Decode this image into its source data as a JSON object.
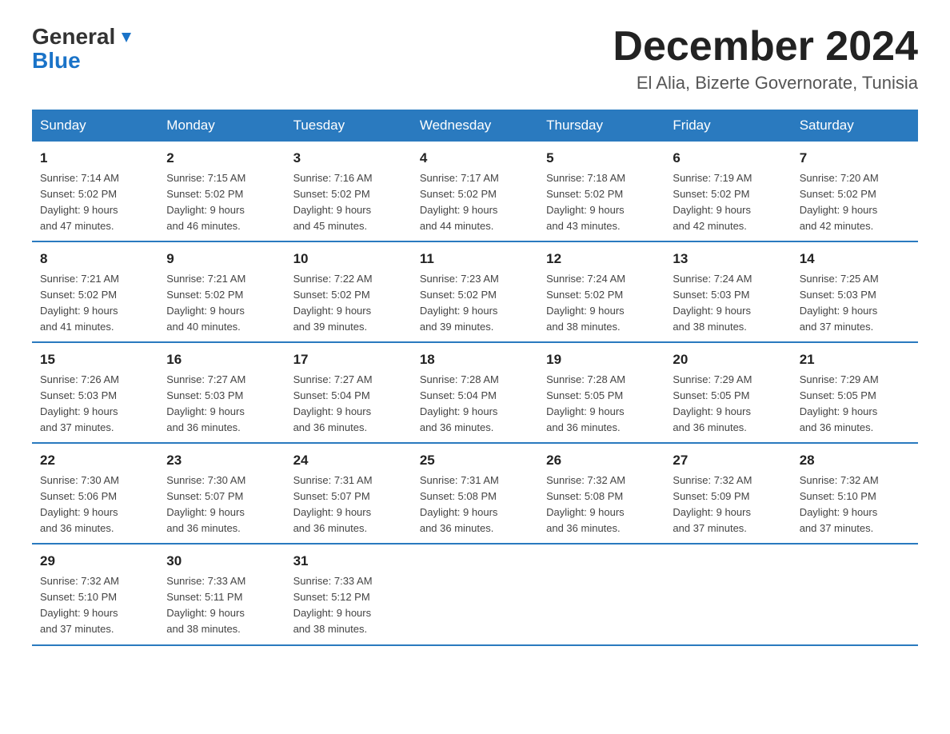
{
  "header": {
    "title": "December 2024",
    "subtitle": "El Alia, Bizerte Governorate, Tunisia",
    "logo_general": "General",
    "logo_blue": "Blue"
  },
  "days_of_week": [
    "Sunday",
    "Monday",
    "Tuesday",
    "Wednesday",
    "Thursday",
    "Friday",
    "Saturday"
  ],
  "weeks": [
    [
      {
        "day": "1",
        "sunrise": "7:14 AM",
        "sunset": "5:02 PM",
        "daylight": "9 hours and 47 minutes."
      },
      {
        "day": "2",
        "sunrise": "7:15 AM",
        "sunset": "5:02 PM",
        "daylight": "9 hours and 46 minutes."
      },
      {
        "day": "3",
        "sunrise": "7:16 AM",
        "sunset": "5:02 PM",
        "daylight": "9 hours and 45 minutes."
      },
      {
        "day": "4",
        "sunrise": "7:17 AM",
        "sunset": "5:02 PM",
        "daylight": "9 hours and 44 minutes."
      },
      {
        "day": "5",
        "sunrise": "7:18 AM",
        "sunset": "5:02 PM",
        "daylight": "9 hours and 43 minutes."
      },
      {
        "day": "6",
        "sunrise": "7:19 AM",
        "sunset": "5:02 PM",
        "daylight": "9 hours and 42 minutes."
      },
      {
        "day": "7",
        "sunrise": "7:20 AM",
        "sunset": "5:02 PM",
        "daylight": "9 hours and 42 minutes."
      }
    ],
    [
      {
        "day": "8",
        "sunrise": "7:21 AM",
        "sunset": "5:02 PM",
        "daylight": "9 hours and 41 minutes."
      },
      {
        "day": "9",
        "sunrise": "7:21 AM",
        "sunset": "5:02 PM",
        "daylight": "9 hours and 40 minutes."
      },
      {
        "day": "10",
        "sunrise": "7:22 AM",
        "sunset": "5:02 PM",
        "daylight": "9 hours and 39 minutes."
      },
      {
        "day": "11",
        "sunrise": "7:23 AM",
        "sunset": "5:02 PM",
        "daylight": "9 hours and 39 minutes."
      },
      {
        "day": "12",
        "sunrise": "7:24 AM",
        "sunset": "5:02 PM",
        "daylight": "9 hours and 38 minutes."
      },
      {
        "day": "13",
        "sunrise": "7:24 AM",
        "sunset": "5:03 PM",
        "daylight": "9 hours and 38 minutes."
      },
      {
        "day": "14",
        "sunrise": "7:25 AM",
        "sunset": "5:03 PM",
        "daylight": "9 hours and 37 minutes."
      }
    ],
    [
      {
        "day": "15",
        "sunrise": "7:26 AM",
        "sunset": "5:03 PM",
        "daylight": "9 hours and 37 minutes."
      },
      {
        "day": "16",
        "sunrise": "7:27 AM",
        "sunset": "5:03 PM",
        "daylight": "9 hours and 36 minutes."
      },
      {
        "day": "17",
        "sunrise": "7:27 AM",
        "sunset": "5:04 PM",
        "daylight": "9 hours and 36 minutes."
      },
      {
        "day": "18",
        "sunrise": "7:28 AM",
        "sunset": "5:04 PM",
        "daylight": "9 hours and 36 minutes."
      },
      {
        "day": "19",
        "sunrise": "7:28 AM",
        "sunset": "5:05 PM",
        "daylight": "9 hours and 36 minutes."
      },
      {
        "day": "20",
        "sunrise": "7:29 AM",
        "sunset": "5:05 PM",
        "daylight": "9 hours and 36 minutes."
      },
      {
        "day": "21",
        "sunrise": "7:29 AM",
        "sunset": "5:05 PM",
        "daylight": "9 hours and 36 minutes."
      }
    ],
    [
      {
        "day": "22",
        "sunrise": "7:30 AM",
        "sunset": "5:06 PM",
        "daylight": "9 hours and 36 minutes."
      },
      {
        "day": "23",
        "sunrise": "7:30 AM",
        "sunset": "5:07 PM",
        "daylight": "9 hours and 36 minutes."
      },
      {
        "day": "24",
        "sunrise": "7:31 AM",
        "sunset": "5:07 PM",
        "daylight": "9 hours and 36 minutes."
      },
      {
        "day": "25",
        "sunrise": "7:31 AM",
        "sunset": "5:08 PM",
        "daylight": "9 hours and 36 minutes."
      },
      {
        "day": "26",
        "sunrise": "7:32 AM",
        "sunset": "5:08 PM",
        "daylight": "9 hours and 36 minutes."
      },
      {
        "day": "27",
        "sunrise": "7:32 AM",
        "sunset": "5:09 PM",
        "daylight": "9 hours and 37 minutes."
      },
      {
        "day": "28",
        "sunrise": "7:32 AM",
        "sunset": "5:10 PM",
        "daylight": "9 hours and 37 minutes."
      }
    ],
    [
      {
        "day": "29",
        "sunrise": "7:32 AM",
        "sunset": "5:10 PM",
        "daylight": "9 hours and 37 minutes."
      },
      {
        "day": "30",
        "sunrise": "7:33 AM",
        "sunset": "5:11 PM",
        "daylight": "9 hours and 38 minutes."
      },
      {
        "day": "31",
        "sunrise": "7:33 AM",
        "sunset": "5:12 PM",
        "daylight": "9 hours and 38 minutes."
      },
      null,
      null,
      null,
      null
    ]
  ],
  "labels": {
    "sunrise": "Sunrise:",
    "sunset": "Sunset:",
    "daylight": "Daylight:"
  }
}
